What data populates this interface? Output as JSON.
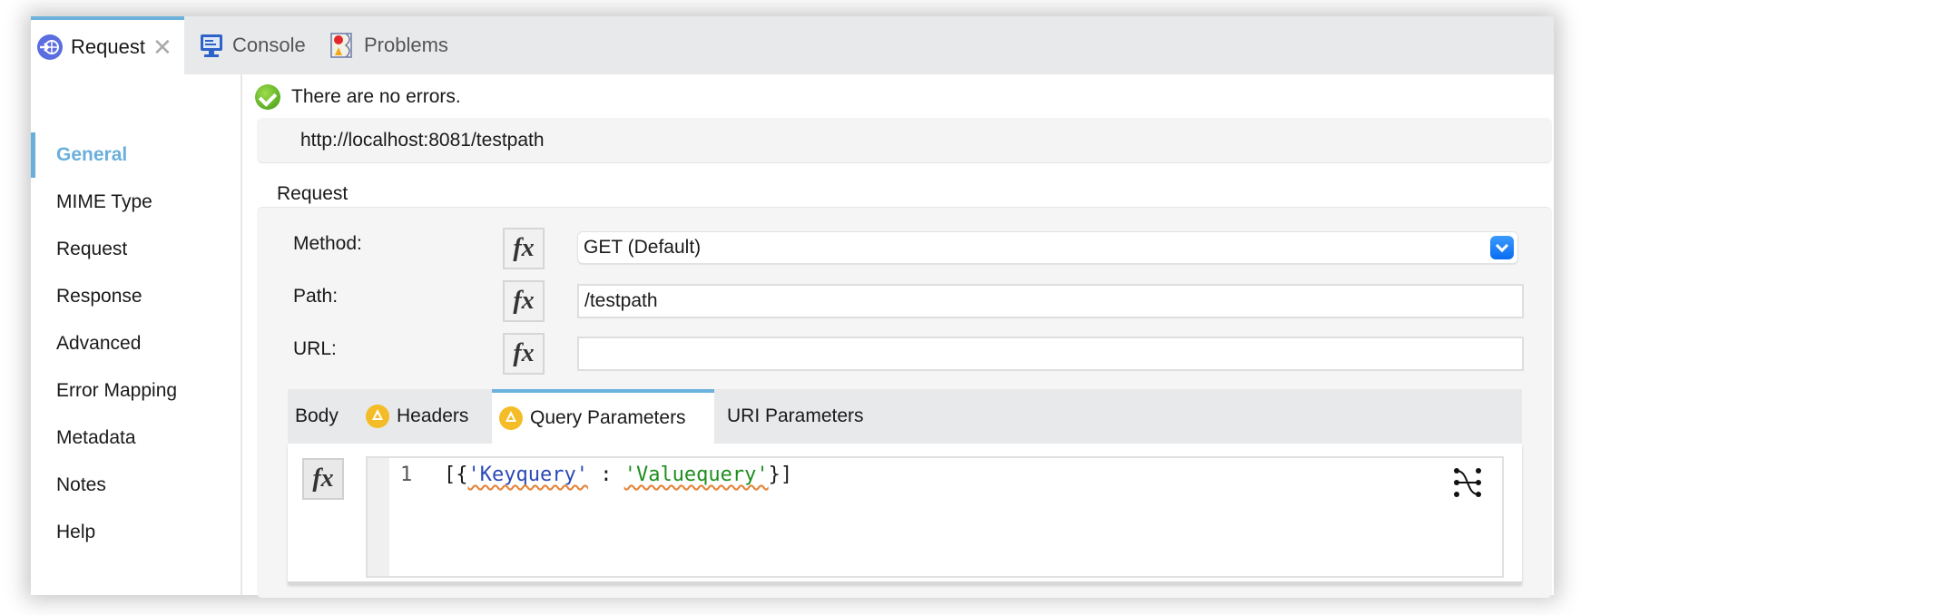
{
  "tabs": [
    {
      "label": "Request",
      "icon": "request-globe-icon",
      "active": true,
      "closable": true
    },
    {
      "label": "Console",
      "icon": "console-monitor-icon",
      "active": false
    },
    {
      "label": "Problems",
      "icon": "problems-map-icon",
      "active": false
    }
  ],
  "sidebar": {
    "items": [
      {
        "label": "General",
        "active": true
      },
      {
        "label": "MIME Type"
      },
      {
        "label": "Request"
      },
      {
        "label": "Response"
      },
      {
        "label": "Advanced"
      },
      {
        "label": "Error Mapping"
      },
      {
        "label": "Metadata"
      },
      {
        "label": "Notes"
      },
      {
        "label": "Help"
      }
    ]
  },
  "status": {
    "message": "There are no errors.",
    "url": "http://localhost:8081/testpath"
  },
  "request_section": {
    "title": "Request",
    "fx_label": "fx",
    "method": {
      "label": "Method:",
      "value": "GET (Default)"
    },
    "path": {
      "label": "Path:",
      "value": "/testpath"
    },
    "url": {
      "label": "URL:",
      "value": ""
    }
  },
  "inner_tabs": [
    {
      "label": "Body",
      "warning": false,
      "active": false
    },
    {
      "label": "Headers",
      "warning": true,
      "active": false
    },
    {
      "label": "Query Parameters",
      "warning": true,
      "active": true
    },
    {
      "label": "URI Parameters",
      "warning": false,
      "active": false
    }
  ],
  "editor": {
    "line_number": "1",
    "code_prefix": "[{",
    "key": "'Keyquery'",
    "separator": " : ",
    "value": "'Valuequery'",
    "code_suffix": "}]"
  },
  "colors": {
    "accent": "#6aafdc",
    "warning": "#f4bd27",
    "success": "#3f9a16",
    "select_button": "#0a6cf0"
  }
}
